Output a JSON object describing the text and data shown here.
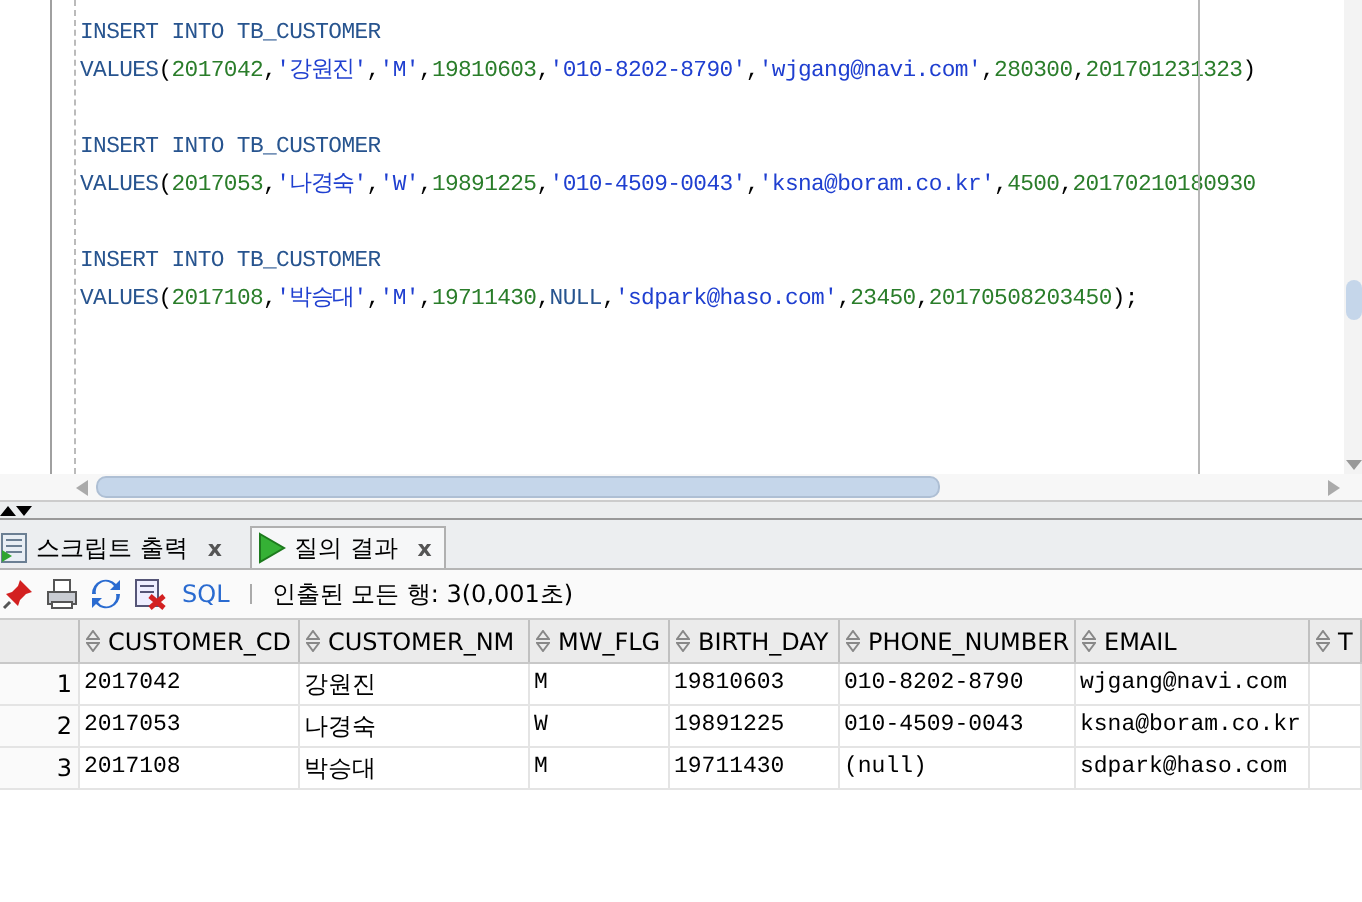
{
  "editor": {
    "statements": [
      {
        "lines": [
          [
            {
              "kind": "kw",
              "text": "INSERT INTO TB_CUSTOMER"
            }
          ],
          [
            {
              "kind": "kw",
              "text": "VALUES"
            },
            {
              "kind": "punct",
              "text": "("
            },
            {
              "kind": "num",
              "text": "2017042"
            },
            {
              "kind": "punct",
              "text": ","
            },
            {
              "kind": "str",
              "text": "'강원진'"
            },
            {
              "kind": "punct",
              "text": ","
            },
            {
              "kind": "str",
              "text": "'M'"
            },
            {
              "kind": "punct",
              "text": ","
            },
            {
              "kind": "num",
              "text": "19810603"
            },
            {
              "kind": "punct",
              "text": ","
            },
            {
              "kind": "str",
              "text": "'010-8202-8790'"
            },
            {
              "kind": "punct",
              "text": ","
            },
            {
              "kind": "str",
              "text": "'wjgang@navi.com'"
            },
            {
              "kind": "punct",
              "text": ","
            },
            {
              "kind": "num",
              "text": "280300"
            },
            {
              "kind": "punct",
              "text": ","
            },
            {
              "kind": "num",
              "text": "201701231323"
            },
            {
              "kind": "punct",
              "text": ")"
            }
          ]
        ]
      },
      {
        "lines": [
          [
            {
              "kind": "kw",
              "text": "INSERT INTO TB_CUSTOMER"
            }
          ],
          [
            {
              "kind": "kw",
              "text": "VALUES"
            },
            {
              "kind": "punct",
              "text": "("
            },
            {
              "kind": "num",
              "text": "2017053"
            },
            {
              "kind": "punct",
              "text": ","
            },
            {
              "kind": "str",
              "text": "'나경숙'"
            },
            {
              "kind": "punct",
              "text": ","
            },
            {
              "kind": "str",
              "text": "'W'"
            },
            {
              "kind": "punct",
              "text": ","
            },
            {
              "kind": "num",
              "text": "19891225"
            },
            {
              "kind": "punct",
              "text": ","
            },
            {
              "kind": "str",
              "text": "'010-4509-0043'"
            },
            {
              "kind": "punct",
              "text": ","
            },
            {
              "kind": "str",
              "text": "'ksna@boram.co.kr'"
            },
            {
              "kind": "punct",
              "text": ","
            },
            {
              "kind": "num",
              "text": "4500"
            },
            {
              "kind": "punct",
              "text": ","
            },
            {
              "kind": "num",
              "text": "20170210180930"
            }
          ]
        ]
      },
      {
        "lines": [
          [
            {
              "kind": "kw",
              "text": "INSERT INTO TB_CUSTOMER"
            }
          ],
          [
            {
              "kind": "kw",
              "text": "VALUES"
            },
            {
              "kind": "punct",
              "text": "("
            },
            {
              "kind": "num",
              "text": "2017108"
            },
            {
              "kind": "punct",
              "text": ","
            },
            {
              "kind": "str",
              "text": "'박승대'"
            },
            {
              "kind": "punct",
              "text": ","
            },
            {
              "kind": "str",
              "text": "'M'"
            },
            {
              "kind": "punct",
              "text": ","
            },
            {
              "kind": "num",
              "text": "19711430"
            },
            {
              "kind": "punct",
              "text": ","
            },
            {
              "kind": "kw",
              "text": "NULL"
            },
            {
              "kind": "punct",
              "text": ","
            },
            {
              "kind": "str",
              "text": "'sdpark@haso.com'"
            },
            {
              "kind": "punct",
              "text": ","
            },
            {
              "kind": "num",
              "text": "23450"
            },
            {
              "kind": "punct",
              "text": ","
            },
            {
              "kind": "num",
              "text": "20170508203450"
            },
            {
              "kind": "punct",
              "text": ");"
            }
          ]
        ]
      }
    ]
  },
  "tabs": [
    {
      "label": "스크립트 출력",
      "close": "x",
      "kind": "script",
      "selected": false
    },
    {
      "label": "질의 결과",
      "close": "x",
      "kind": "run",
      "selected": true
    }
  ],
  "toolbar": {
    "sql_link": "SQL",
    "status": "인출된 모든 행: 3(0,001초)"
  },
  "table": {
    "columns": [
      "CUSTOMER_CD",
      "CUSTOMER_NM",
      "MW_FLG",
      "BIRTH_DAY",
      "PHONE_NUMBER",
      "EMAIL",
      "T"
    ],
    "rows": [
      {
        "number": "1",
        "cells": [
          "2017042",
          "강원진",
          "M",
          "19810603",
          "010-8202-8790",
          "wjgang@navi.com"
        ]
      },
      {
        "number": "2",
        "cells": [
          "2017053",
          "나경숙",
          "W",
          "19891225",
          "010-4509-0043",
          "ksna@boram.co.kr"
        ]
      },
      {
        "number": "3",
        "cells": [
          "2017108",
          "박승대",
          "M",
          "19711430",
          "(null)",
          "sdpark@haso.com"
        ]
      }
    ]
  }
}
